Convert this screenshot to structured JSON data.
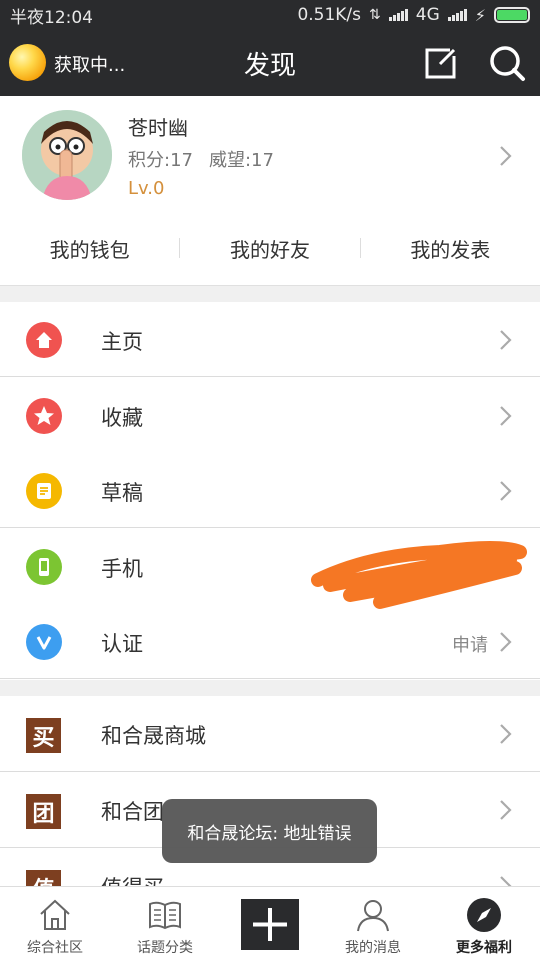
{
  "status_bar": {
    "time": "半夜12:04",
    "net_speed": "0.51K/s",
    "network": "4G"
  },
  "header": {
    "loading_text": "获取中...",
    "title": "发现"
  },
  "profile": {
    "name": "苍时幽",
    "points": "积分:17",
    "prestige": "威望:17",
    "level": "Lv.0",
    "links": [
      "我的钱包",
      "我的好友",
      "我的发表"
    ]
  },
  "menu": {
    "group1": [
      {
        "label": "主页",
        "icon": "home-icon"
      },
      {
        "label": "收藏",
        "icon": "star-icon"
      },
      {
        "label": "草稿",
        "icon": "draft-icon"
      }
    ],
    "group2": [
      {
        "label": "手机",
        "icon": "phone-icon"
      },
      {
        "label": "认证",
        "icon": "verify-icon",
        "extra": "申请"
      }
    ],
    "group3": [
      {
        "label": "和合晟商城",
        "badge": "买"
      },
      {
        "label": "和合团",
        "badge": "团"
      },
      {
        "label": "值得买",
        "badge": "值"
      }
    ]
  },
  "toast": "和合晟论坛: 地址错误",
  "tabs": [
    {
      "label": "综合社区",
      "icon": "community-icon"
    },
    {
      "label": "话题分类",
      "icon": "book-icon"
    },
    {
      "label": "",
      "icon": "plus-icon"
    },
    {
      "label": "我的消息",
      "icon": "person-icon"
    },
    {
      "label": "更多福利",
      "icon": "compass-icon",
      "active": true
    }
  ],
  "colors": {
    "dark_bar": "#2a2b2d",
    "home": "#f05350",
    "star": "#f05350",
    "draft": "#f5b800",
    "phone": "#7cc532",
    "verify": "#3d9ef0",
    "shop_badge": "#7d3f20",
    "level": "#d4903c",
    "scribble": "#f57724"
  }
}
